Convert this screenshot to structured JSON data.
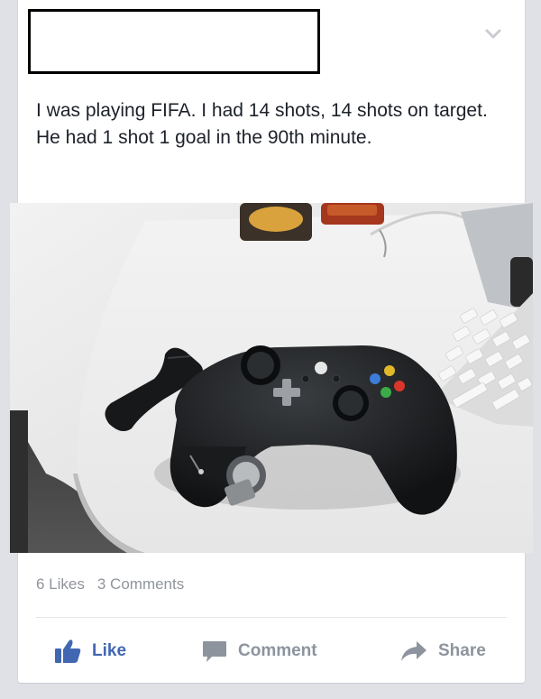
{
  "post": {
    "author_redacted": true,
    "text": "I was playing FIFA. I had 14 shots, 14 shots on target. He had 1 shot 1 goal in the 90th minute.",
    "photo_icon": "game-controller-photo"
  },
  "stats": {
    "likes": "6 Likes",
    "comments": "3 Comments"
  },
  "actions": {
    "like_label": "Like",
    "comment_label": "Comment",
    "share_label": "Share"
  },
  "colors": {
    "like_blue": "#4267b2",
    "muted_gray": "#8d949e",
    "text": "#1d2129"
  }
}
